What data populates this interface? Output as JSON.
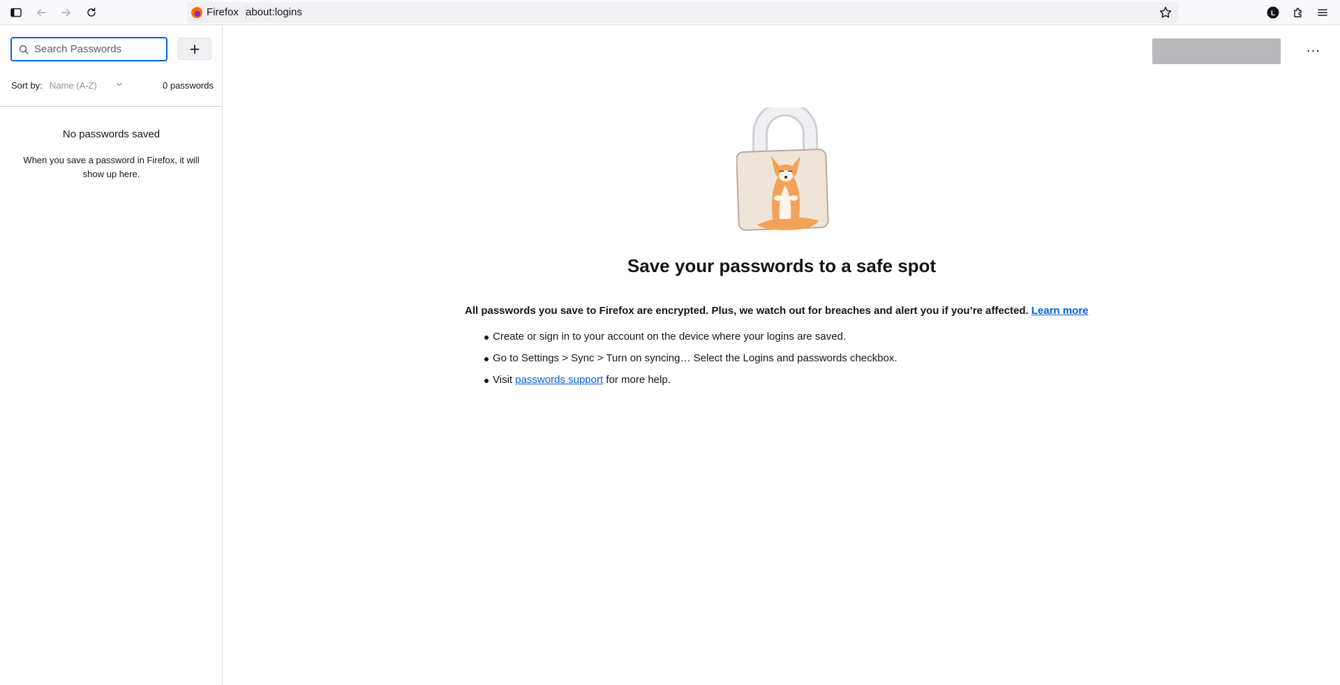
{
  "browser": {
    "identity_label": "Firefox",
    "url": "about:logins",
    "icons": [
      "sidebar-icon",
      "back-icon",
      "forward-icon",
      "reload-icon",
      "star-icon",
      "account-icon",
      "extensions-icon",
      "menu-icon"
    ],
    "account_initial": "L"
  },
  "sidebar": {
    "search_placeholder": "Search Passwords",
    "add_label": "+",
    "sort_label": "Sort by:",
    "sort_value": "Name (A-Z)",
    "count": "0 passwords",
    "empty_title": "No passwords saved",
    "empty_description": "When you save a password in Firefox, it will show up here."
  },
  "main": {
    "more_label": "···",
    "headline": "Save your passwords to a safe spot",
    "info_text": "All passwords you save to Firefox are encrypted. Plus, we watch out for breaches and alert you if you’re affected.",
    "learn_more": "Learn more",
    "step1": "Create or sign in to your account on the device where your logins are saved.",
    "step2": "Go to Settings > Sync > Turn on syncing… Select the Logins and passwords checkbox.",
    "step3_prefix": "Visit",
    "step3_link": "passwords support",
    "step3_suffix": "for more help."
  },
  "colors": {
    "accent": "#0061e0",
    "toolbar_bg": "#f9f9fb",
    "urlbar_bg": "#f0f0f4",
    "placeholder_block": "#b8b8bd"
  }
}
